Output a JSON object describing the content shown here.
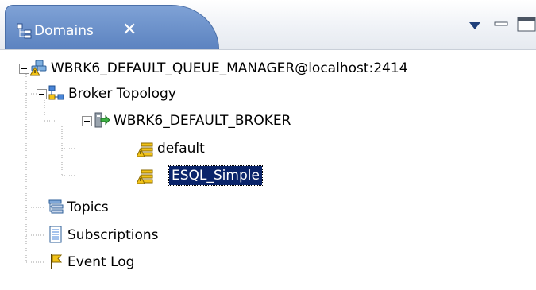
{
  "view": {
    "tab_label": "Domains",
    "tab_icon": "domains-view-icon",
    "close_glyph": "✕",
    "toolbar_icons": [
      "view-menu-icon",
      "minimize-icon",
      "maximize-icon"
    ]
  },
  "tree": {
    "queue_manager": {
      "label": "WBRK6_DEFAULT_QUEUE_MANAGER@localhost:2414",
      "icon": "queue-manager-warning-icon",
      "expanded": true
    },
    "broker_topology": {
      "label": "Broker Topology",
      "icon": "broker-topology-icon",
      "expanded": true
    },
    "broker": {
      "label": "WBRK6_DEFAULT_BROKER",
      "icon": "broker-icon",
      "expanded": true
    },
    "execution_groups": [
      {
        "label": "default",
        "icon": "execution-group-warning-icon",
        "selected": false
      },
      {
        "label": "ESQL_Simple",
        "icon": "execution-group-warning-icon",
        "selected": true
      }
    ],
    "topics": {
      "label": "Topics",
      "icon": "topics-icon"
    },
    "subscriptions": {
      "label": "Subscriptions",
      "icon": "subscriptions-icon"
    },
    "event_log": {
      "label": "Event Log",
      "icon": "event-log-flag-icon"
    }
  },
  "colors": {
    "tab": "#6f93cc",
    "selection": "#0a246a",
    "warning": "#f2c318"
  }
}
